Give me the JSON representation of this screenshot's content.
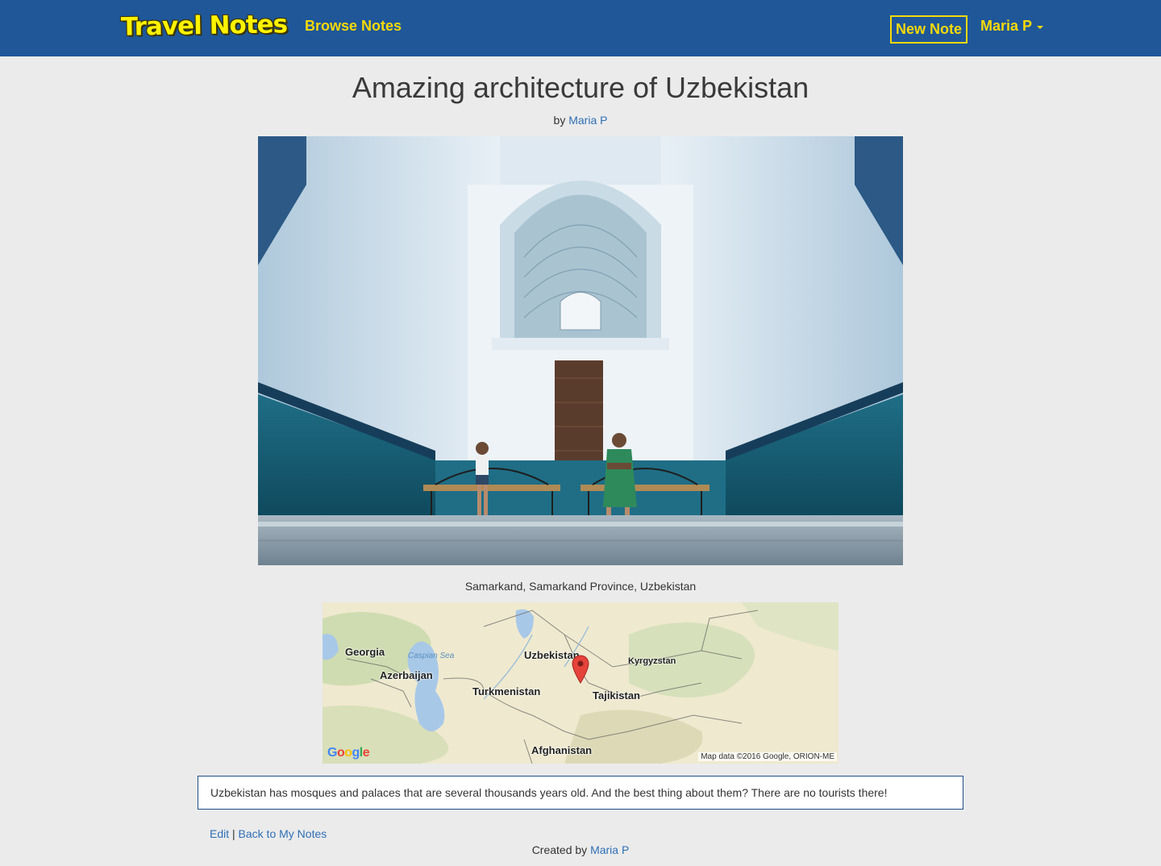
{
  "navbar": {
    "brand": "Travel Notes",
    "browse_label": "Browse Notes",
    "new_note_label": "New Note",
    "user_label": "Maria P",
    "colors": {
      "bar": "#1f5799",
      "accent": "#f5d90a"
    }
  },
  "note": {
    "title": "Amazing architecture of Uzbekistan",
    "by_prefix": "by",
    "author": "Maria P",
    "location": "Samarkand, Samarkand Province, Uzbekistan",
    "description": "Uzbekistan has mosques and palaces that are several thousands years old. And the best thing about them? There are no tourists there!"
  },
  "map": {
    "labels": {
      "georgia": "Georgia",
      "caspian": "Caspian Sea",
      "azerbaijan": "Azerbaijan",
      "uzbekistan": "Uzbekistan",
      "kyrgyzstan": "Kyrgyzstan",
      "turkmenistan": "Turkmenistan",
      "tajikistan": "Tajikistan",
      "afghanistan": "Afghanistan"
    },
    "logo": "Google",
    "attribution": "Map data ©2016 Google, ORION-ME"
  },
  "actions": {
    "edit_label": "Edit",
    "separator": "|",
    "back_label": "Back to My Notes"
  },
  "footer": {
    "created_prefix": "Created by",
    "author": "Maria P"
  }
}
